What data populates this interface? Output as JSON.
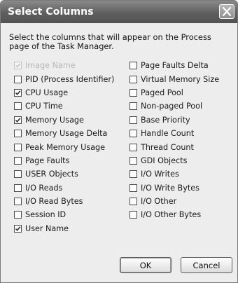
{
  "window": {
    "title": "Select Columns",
    "close_glyph": "close-icon"
  },
  "description": "Select the columns that will appear on the Process page of the Task Manager.",
  "columns_left": [
    {
      "label": "Image Name",
      "checked": true,
      "disabled": true
    },
    {
      "label": "PID (Process Identifier)",
      "checked": false,
      "disabled": false
    },
    {
      "label": "CPU Usage",
      "checked": true,
      "disabled": false
    },
    {
      "label": "CPU Time",
      "checked": false,
      "disabled": false
    },
    {
      "label": "Memory Usage",
      "checked": true,
      "disabled": false
    },
    {
      "label": "Memory Usage Delta",
      "checked": false,
      "disabled": false
    },
    {
      "label": "Peak Memory Usage",
      "checked": false,
      "disabled": false
    },
    {
      "label": "Page Faults",
      "checked": false,
      "disabled": false
    },
    {
      "label": "USER Objects",
      "checked": false,
      "disabled": false
    },
    {
      "label": "I/O Reads",
      "checked": false,
      "disabled": false
    },
    {
      "label": "I/O Read Bytes",
      "checked": false,
      "disabled": false
    },
    {
      "label": "Session ID",
      "checked": false,
      "disabled": false
    },
    {
      "label": "User Name",
      "checked": true,
      "disabled": false
    }
  ],
  "columns_right": [
    {
      "label": "Page Faults Delta",
      "checked": false,
      "disabled": false
    },
    {
      "label": "Virtual Memory Size",
      "checked": false,
      "disabled": false
    },
    {
      "label": "Paged Pool",
      "checked": false,
      "disabled": false
    },
    {
      "label": "Non-paged Pool",
      "checked": false,
      "disabled": false
    },
    {
      "label": "Base Priority",
      "checked": false,
      "disabled": false
    },
    {
      "label": "Handle Count",
      "checked": false,
      "disabled": false
    },
    {
      "label": "Thread Count",
      "checked": false,
      "disabled": false
    },
    {
      "label": "GDI Objects",
      "checked": false,
      "disabled": false
    },
    {
      "label": "I/O Writes",
      "checked": false,
      "disabled": false
    },
    {
      "label": "I/O Write Bytes",
      "checked": false,
      "disabled": false
    },
    {
      "label": "I/O Other",
      "checked": false,
      "disabled": false
    },
    {
      "label": "I/O Other Bytes",
      "checked": false,
      "disabled": false
    }
  ],
  "buttons": {
    "ok_label": "OK",
    "cancel_label": "Cancel"
  }
}
